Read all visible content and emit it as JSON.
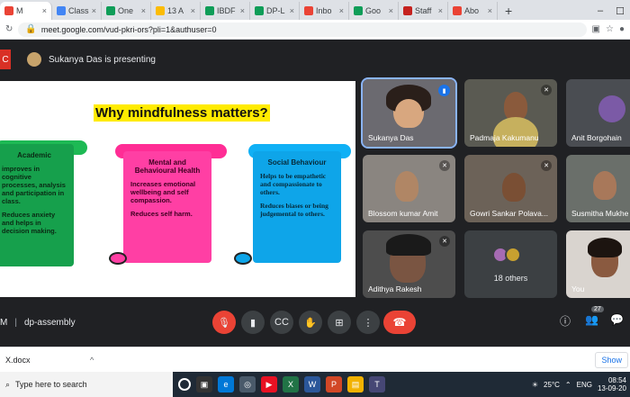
{
  "browser": {
    "tabs": [
      {
        "label": "M",
        "color": "#ea4335",
        "active": true
      },
      {
        "label": "Class",
        "color": "#4285f4"
      },
      {
        "label": "One",
        "color": "#0f9d58"
      },
      {
        "label": "13 A",
        "color": "#fbbc04"
      },
      {
        "label": "IBDF",
        "color": "#0f9d58"
      },
      {
        "label": "DP-L",
        "color": "#0f9d58"
      },
      {
        "label": "Inbo",
        "color": "#ea4335"
      },
      {
        "label": "Goo",
        "color": "#0f9d58"
      },
      {
        "label": "Staff",
        "color": "#c5221f"
      },
      {
        "label": "Abo",
        "color": "#ea4335"
      }
    ],
    "new_tab": "+",
    "url": "meet.google.com/vud-pkri-ors?pli=1&authuser=0"
  },
  "meet": {
    "presenting_text": "Sukanya Das is presenting",
    "meeting_name_prefix": "M",
    "meeting_name": "dp-assembly",
    "people_count": "27"
  },
  "slide": {
    "title": "Why mindfulness matters?",
    "cards": [
      {
        "heading": "Academic",
        "lines": [
          "improves in cognitive processes, analysis and participation in class.",
          "Reduces anxiety and helps in decision making."
        ]
      },
      {
        "heading": "Mental and Behavioural Health",
        "lines": [
          "Increases emotional wellbeing and self compassion.",
          "Reduces self harm."
        ]
      },
      {
        "heading": "Social Behaviour",
        "lines": [
          "Helps to be empathetic and compassionate to others.",
          "Reduces biases or being judgemental to others."
        ]
      }
    ]
  },
  "participants": [
    {
      "name": "Sukanya Das",
      "active": true
    },
    {
      "name": "Padmaja Kakumanu"
    },
    {
      "name": "Anit Borgohain"
    },
    {
      "name": "Blossom kumar Amit"
    },
    {
      "name": "Gowri Sankar Polava..."
    },
    {
      "name": "Susmitha Mukhe"
    },
    {
      "name": "Adithya Rakesh"
    },
    {
      "name": "You"
    }
  ],
  "others_label": "18 others",
  "download": {
    "file": "X.docx",
    "show_all": "Show"
  },
  "taskbar": {
    "search_placeholder": "Type here to search",
    "temperature": "25°C",
    "lang": "ENG",
    "time": "08:54",
    "date": "13-09-20"
  }
}
